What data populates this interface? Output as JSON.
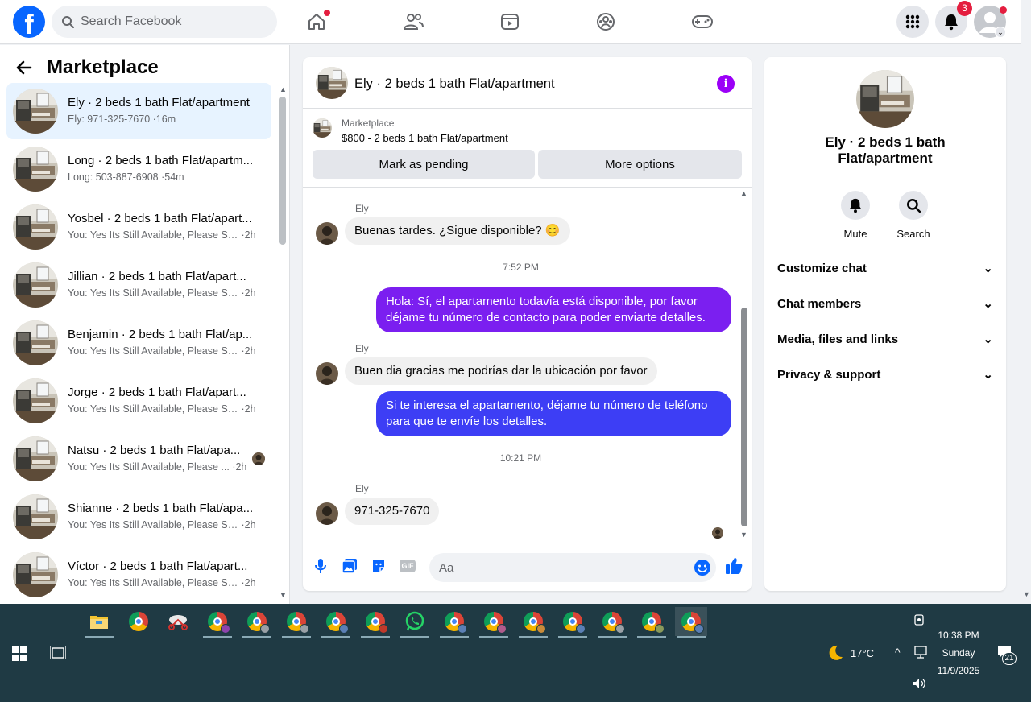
{
  "topbar": {
    "search_placeholder": "Search Facebook",
    "notifications_count": "3"
  },
  "left": {
    "title": "Marketplace",
    "conversations": [
      {
        "title": "Ely · 2 beds 1 bath Flat/apartment",
        "snippet": "Ely: 971-325-7670",
        "time": "16m",
        "active": true
      },
      {
        "title": "Long · 2 beds 1 bath Flat/apartm...",
        "snippet": "Long: 503-887-6908",
        "time": "54m"
      },
      {
        "title": "Yosbel · 2 beds 1 bath Flat/apart...",
        "snippet": "You: Yes Its Still Available, Please Se...",
        "time": "2h"
      },
      {
        "title": "Jillian · 2 beds 1 bath Flat/apart...",
        "snippet": "You: Yes Its Still Available, Please Se...",
        "time": "2h"
      },
      {
        "title": "Benjamin · 2 beds 1 bath Flat/ap...",
        "snippet": "You: Yes Its Still Available, Please Se...",
        "time": "2h"
      },
      {
        "title": "Jorge · 2 beds 1 bath Flat/apart...",
        "snippet": "You: Yes Its Still Available, Please Se...",
        "time": "2h"
      },
      {
        "title": "Natsu · 2 beds 1 bath Flat/apa...",
        "snippet": "You: Yes Its Still Available, Please ...",
        "time": "2h"
      },
      {
        "title": "Shianne · 2 beds 1 bath Flat/apa...",
        "snippet": "You: Yes Its Still Available, Please Se...",
        "time": "2h"
      },
      {
        "title": "Víctor · 2 beds 1 bath Flat/apart...",
        "snippet": "You: Yes Its Still Available, Please Se...",
        "time": "2h"
      }
    ]
  },
  "chat": {
    "title": "Ely · 2 beds 1 bath Flat/apartment",
    "marketplace_label": "Marketplace",
    "listing": "$800 - 2 beds 1 bath Flat/apartment",
    "mark_pending": "Mark as pending",
    "more_options": "More options",
    "messages": {
      "m1_sender": "Ely",
      "m1_text": "Buenas tardes. ¿Sigue disponible? 😊",
      "ts1": "7:52 PM",
      "m2_text": "Hola: Sí, el apartamento todavía está disponible, por favor déjame tu número de contacto para poder enviarte detalles.",
      "m3_sender": "Ely",
      "m3_text": "Buen dia gracias me podrías dar la ubicación por favor",
      "m4_text": "Si te interesa el apartamento, déjame tu número de teléfono para que te envíe los detalles.",
      "ts2": "10:21 PM",
      "m5_sender": "Ely",
      "m5_text": "971-325-7670"
    },
    "composer_placeholder": "Aa",
    "gif_label": "GIF"
  },
  "right": {
    "name": "Ely · 2 beds 1 bath Flat/apartment",
    "mute": "Mute",
    "search": "Search",
    "sections": [
      "Customize chat",
      "Chat members",
      "Media, files and links",
      "Privacy & support"
    ]
  },
  "taskbar": {
    "weather": "17°C",
    "time": "10:38 PM",
    "day": "Sunday",
    "date": "11/9/2025",
    "notif_count": "21"
  },
  "colors": {
    "fb_blue": "#0866ff",
    "bubble_purple": "#7b1ff0",
    "bubble_blue": "#3d3ef5",
    "messenger_blue": "#0866ff",
    "taskbar": "#1f3a44"
  }
}
